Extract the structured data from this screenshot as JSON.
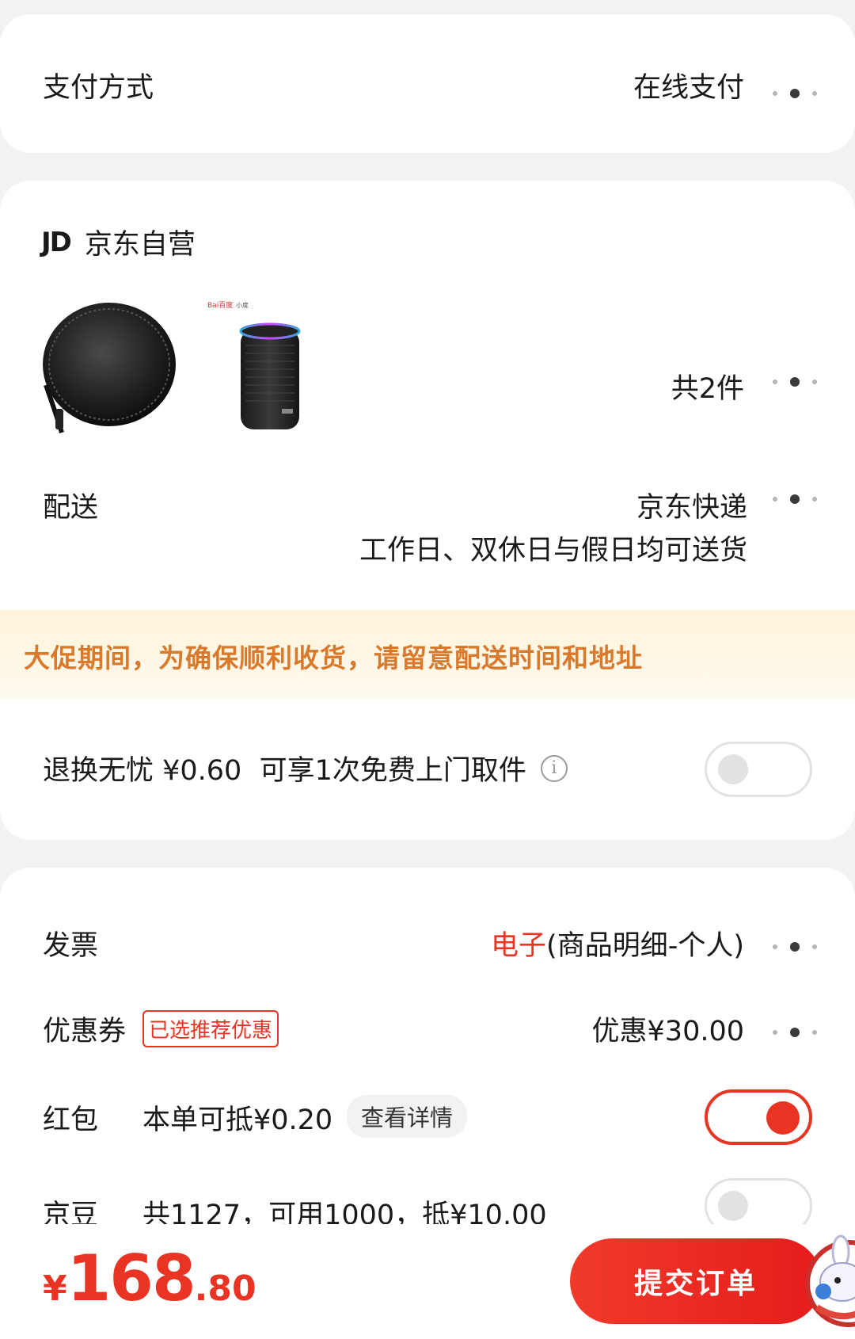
{
  "payment": {
    "label": "支付方式",
    "value": "在线支付"
  },
  "store": {
    "logo": "JD",
    "name": "京东自营"
  },
  "products": {
    "count_label": "共2件",
    "images": [
      "earphone-case",
      "smart-speaker"
    ],
    "speaker_brand": "Bai百度",
    "speaker_sub": "小度"
  },
  "delivery": {
    "label": "配送",
    "carrier": "京东快递",
    "note": "工作日、双休日与假日均可送货"
  },
  "banner": {
    "text": "大促期间，为确保顺利收货，请留意配送时间和地址"
  },
  "return_insurance": {
    "label": "退换无忧 ¥0.60  可享1次免费上门取件",
    "enabled": false
  },
  "invoice": {
    "label": "发票",
    "type": "电子",
    "detail": "(商品明细-个人)"
  },
  "coupon": {
    "label": "优惠券",
    "tag": "已选推荐优惠",
    "value": "优惠¥30.00"
  },
  "red_packet": {
    "label": "红包",
    "value": "本单可抵¥0.20",
    "detail_button": "查看详情",
    "enabled": true
  },
  "jingdou": {
    "label": "京豆",
    "value": "共1127，可用1000，抵¥10.00",
    "enabled": false
  },
  "total": {
    "currency": "¥",
    "integer": "168",
    "decimal": ".80"
  },
  "submit": {
    "label": "提交订单"
  },
  "colors": {
    "accent": "#e93323",
    "banner_text": "#d8792c"
  }
}
